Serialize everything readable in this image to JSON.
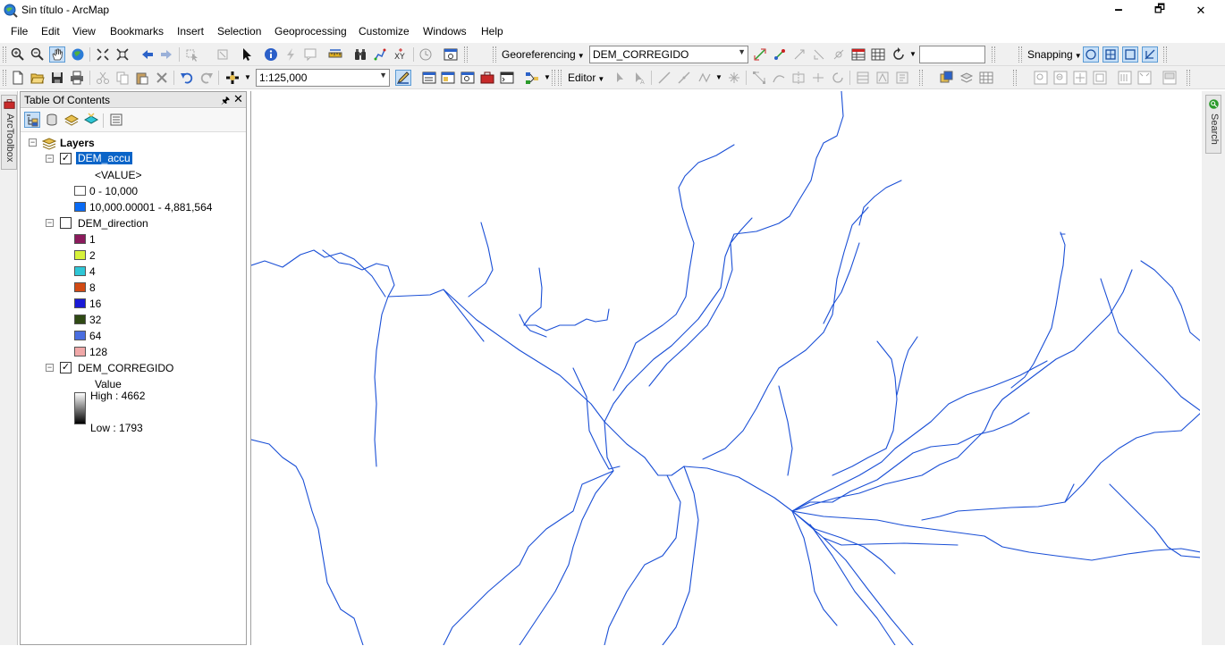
{
  "window": {
    "title": "Sin título - ArcMap",
    "minimize": "🗕",
    "maximize": "🗗",
    "close": "✕"
  },
  "menu": [
    "File",
    "Edit",
    "View",
    "Bookmarks",
    "Insert",
    "Selection",
    "Geoprocessing",
    "Customize",
    "Windows",
    "Help"
  ],
  "toolbar": {
    "georeferencing_label": "Georeferencing",
    "georef_layer": "DEM_CORREGIDO",
    "snapping_label": "Snapping",
    "scale": "1:125,000",
    "editor_label": "Editor",
    "dropdown_arrow": "▼"
  },
  "side_tabs": {
    "left": "ArcToolbox",
    "right": "Search"
  },
  "toc": {
    "title": "Table Of Contents",
    "pin": "🖈",
    "close": "✕",
    "root": "Layers",
    "layers": [
      {
        "name": "DEM_accu",
        "checked": true,
        "field": "<VALUE>",
        "classes": [
          {
            "label": "0 - 10,000",
            "color": "#ffffff"
          },
          {
            "label": "10,000.00001 - 4,881,564",
            "color": "#0a6bf5"
          }
        ]
      },
      {
        "name": "DEM_direction",
        "checked": false,
        "classes": [
          {
            "label": "1",
            "color": "#8b1a5c"
          },
          {
            "label": "2",
            "color": "#d7f23a"
          },
          {
            "label": "4",
            "color": "#2ec6d6"
          },
          {
            "label": "8",
            "color": "#d24a14"
          },
          {
            "label": "16",
            "color": "#1a1ad6"
          },
          {
            "label": "32",
            "color": "#2f4a14"
          },
          {
            "label": "64",
            "color": "#4a6ee0"
          },
          {
            "label": "128",
            "color": "#f0a8a8"
          }
        ]
      },
      {
        "name": "DEM_CORREGIDO",
        "checked": true,
        "value_label": "Value",
        "high": "High : 4662",
        "low": "Low : 1793"
      }
    ]
  },
  "colors": {
    "stream": "#1a4fd6",
    "selection": "#0a64c8"
  }
}
